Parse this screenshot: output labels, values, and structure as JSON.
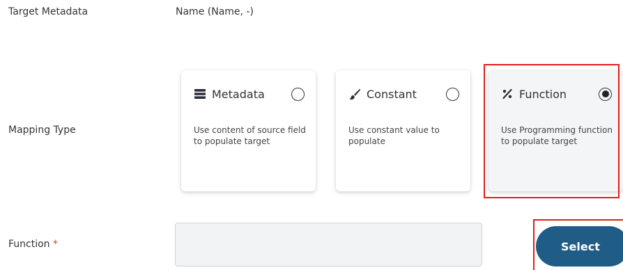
{
  "target_metadata": {
    "label": "Target Metadata",
    "value": "Name (Name, -)"
  },
  "mapping_type": {
    "label": "Mapping Type",
    "options": [
      {
        "title": "Metadata",
        "icon": "list-icon",
        "description": "Use content of source field to populate target",
        "selected": false
      },
      {
        "title": "Constant",
        "icon": "brush-icon",
        "description": "Use constant value to populate",
        "selected": false
      },
      {
        "title": "Function",
        "icon": "function-icon",
        "description": "Use Programming function to populate target",
        "selected": true
      }
    ]
  },
  "function": {
    "label": "Function",
    "required_marker": "*",
    "value": "",
    "select_label": "Select"
  },
  "colors": {
    "highlight": "#e11b1b",
    "button": "#1f5d86",
    "required": "#e53935"
  }
}
